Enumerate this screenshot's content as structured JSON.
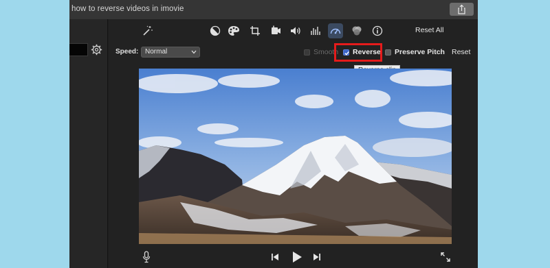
{
  "window": {
    "title": "how to reverse videos in imovie"
  },
  "toolbar": {
    "tools": [
      "magic-wand",
      "color-balance",
      "color-correction",
      "crop",
      "stabilization",
      "volume",
      "noise-reduction",
      "speed",
      "clip-filter",
      "info"
    ],
    "reset_all_label": "Reset All"
  },
  "speed_panel": {
    "speed_label": "Speed:",
    "speed_value": "Normal",
    "smooth_label": "Smooth",
    "reverse_label": "Reverse",
    "reverse_checked": true,
    "preserve_pitch_label": "Preserve Pitch",
    "preserve_pitch_checked": false,
    "reset_label": "Reset",
    "tooltip": "Reverse clip"
  },
  "colors": {
    "highlight": "#e51b1b",
    "checkbox_checked": "#3c64c7",
    "background": "#9ed8ec"
  },
  "playback": {
    "controls": [
      "mic-icon",
      "previous-icon",
      "play-icon",
      "next-icon",
      "fullscreen-icon"
    ]
  }
}
